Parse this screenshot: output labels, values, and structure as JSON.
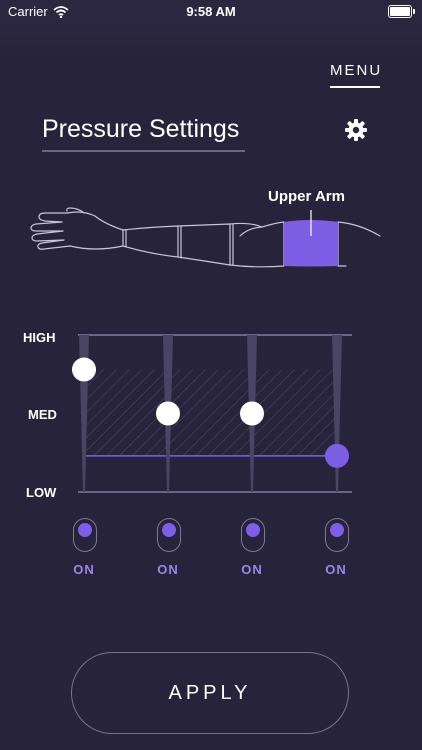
{
  "status_bar": {
    "carrier": "Carrier",
    "time": "9:58 AM"
  },
  "header": {
    "menu_label": "MENU"
  },
  "page": {
    "title": "Pressure Settings"
  },
  "arm": {
    "selected_region": "Upper Arm"
  },
  "pressure": {
    "levels": [
      "HIGH",
      "MED",
      "LOW"
    ],
    "channels": [
      {
        "level_fraction": 0.78,
        "state": "ON"
      },
      {
        "level_fraction": 0.5,
        "state": "ON"
      },
      {
        "level_fraction": 0.5,
        "state": "ON"
      },
      {
        "level_fraction": 0.23,
        "state": "ON"
      }
    ]
  },
  "actions": {
    "apply_label": "APPLY"
  },
  "colors": {
    "background": "#27233a",
    "accent": "#7d5fe6",
    "muted": "#4a4563"
  }
}
